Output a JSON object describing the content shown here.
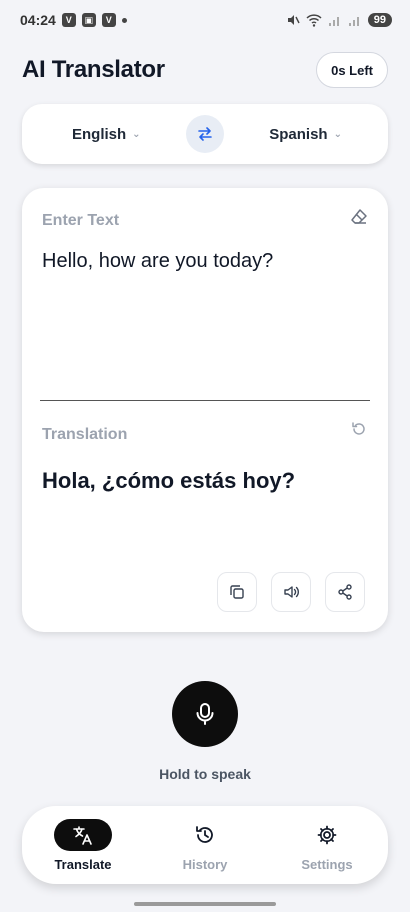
{
  "status_bar": {
    "time": "04:24",
    "app_icons": [
      "V",
      "▣",
      "V"
    ],
    "battery": "99"
  },
  "header": {
    "title": "AI Translator",
    "time_left": "0s Left"
  },
  "language_bar": {
    "source_language": "English",
    "target_language": "Spanish"
  },
  "input": {
    "label": "Enter Text",
    "text": "Hello, how are you today?"
  },
  "translation": {
    "label": "Translation",
    "text": "Hola, ¿cómo estás hoy?"
  },
  "voice": {
    "hold_label": "Hold to speak"
  },
  "bottom_nav": {
    "items": [
      {
        "label": "Translate",
        "icon": "translate-icon",
        "active": true
      },
      {
        "label": "History",
        "icon": "history-icon",
        "active": false
      },
      {
        "label": "Settings",
        "icon": "gear-icon",
        "active": false
      }
    ]
  },
  "colors": {
    "background": "#f3f4f8",
    "accent_dark": "#0d0d0d",
    "muted_text": "#9ca3af",
    "swap_accent": "#2563eb"
  }
}
